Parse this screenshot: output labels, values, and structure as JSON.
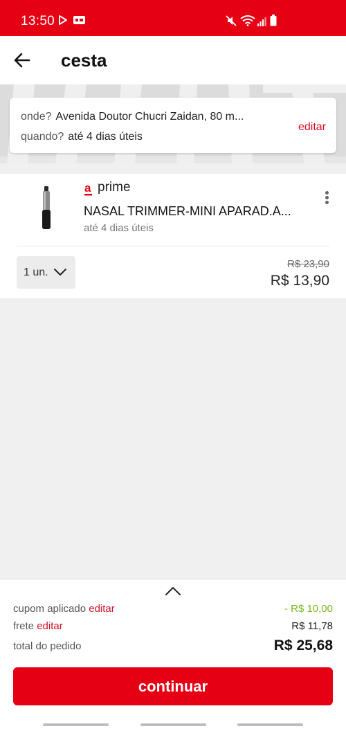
{
  "status_bar": {
    "time": "13:50",
    "background": "#e60014",
    "icons": [
      "play-store-icon",
      "caption-icon",
      "mute-icon",
      "wifi-icon",
      "signal-icon",
      "battery-icon"
    ]
  },
  "header": {
    "back_icon": "arrow-left-icon",
    "title": "cesta"
  },
  "delivery": {
    "where_label": "onde?",
    "where_value": "Avenida Doutor Chucri Zaidan, 80 m...",
    "when_label": "quando?",
    "when_value": "até 4 dias úteis",
    "edit_label": "editar"
  },
  "item": {
    "badge_logo": "americanas-a-logo",
    "badge_text": "prime",
    "name": "NASAL TRIMMER-MINI APARAD.A...",
    "delivery": "até 4 dias úteis",
    "menu_icon": "more-vertical-icon",
    "quantity": "1 un.",
    "old_price": "R$ 23,90",
    "price": "R$ 13,90"
  },
  "summary": {
    "expand_icon": "chevron-up-icon",
    "coupon_label": "cupom aplicado",
    "coupon_edit": "editar",
    "coupon_value": "- R$ 10,00",
    "shipping_label": "frete",
    "shipping_edit": "editar",
    "shipping_value": "R$ 11,78",
    "total_label": "total do pedido",
    "total_value": "R$ 25,68",
    "continue_label": "continuar"
  },
  "colors": {
    "brand_red": "#e60014",
    "link_red": "#d50f25",
    "discount_green": "#7ab51d",
    "background": "#f0f0f0"
  }
}
